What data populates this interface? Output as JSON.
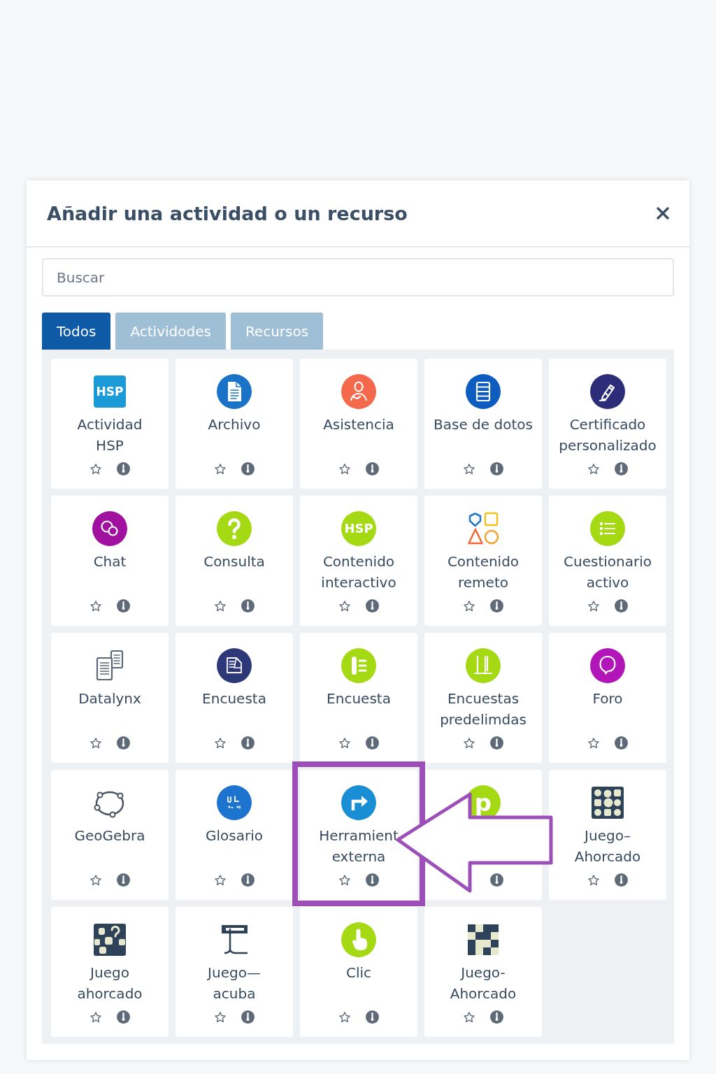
{
  "dialog": {
    "title": "Añadir una actividad o un recurso",
    "search": {
      "placeholder": "Buscar"
    },
    "tabs": [
      {
        "label": "Todos",
        "selected": true
      },
      {
        "label": "Actividodes",
        "selected": false
      },
      {
        "label": "Recursos",
        "selected": false
      }
    ],
    "items": [
      {
        "label": "Actividad\nHSP",
        "icon_text": "HSP",
        "starred": false,
        "highlighted": false
      },
      {
        "label": "Archivo",
        "starred": false,
        "highlighted": false
      },
      {
        "label": "Asistencia",
        "starred": false,
        "highlighted": false
      },
      {
        "label": "Base de dotos",
        "starred": false,
        "highlighted": false
      },
      {
        "label": "Certificado\npersonalizado",
        "starred": false,
        "highlighted": false
      },
      {
        "label": "Chat",
        "starred": false,
        "highlighted": false
      },
      {
        "label": "Consulta",
        "starred": false,
        "highlighted": false
      },
      {
        "label": "Contenido\ninteractivo",
        "icon_text": "HSP",
        "starred": false,
        "highlighted": false
      },
      {
        "label": "Contenido\nremeto",
        "starred": false,
        "highlighted": false
      },
      {
        "label": "Cuestionario\nactivo",
        "starred": false,
        "highlighted": false
      },
      {
        "label": "Datalynx",
        "starred": false,
        "highlighted": false
      },
      {
        "label": "Encuesta",
        "starred": false,
        "highlighted": false
      },
      {
        "label": "Encuesta",
        "starred": false,
        "highlighted": false
      },
      {
        "label": "Encuestas\npredelimdas",
        "starred": false,
        "highlighted": false
      },
      {
        "label": "Foro",
        "starred": false,
        "highlighted": false
      },
      {
        "label": "GeoGebra",
        "starred": false,
        "highlighted": false
      },
      {
        "label": "Glosario",
        "starred": false,
        "highlighted": false
      },
      {
        "label": "Herramient\nexterna",
        "starred": false,
        "highlighted": true
      },
      {
        "icon_text": "p",
        "highlighted": false
      },
      {
        "label": "Juego–\nAhorcado",
        "starred": false,
        "highlighted": false
      },
      {
        "label": "Juego\nahorcado",
        "starred": false,
        "highlighted": false
      },
      {
        "label": "Juego—\nacuba",
        "starred": false,
        "highlighted": false
      },
      {
        "label": "Clic",
        "starred": false,
        "highlighted": false
      },
      {
        "label": "Juego-\nAhorcado",
        "starred": false,
        "highlighted": false
      }
    ]
  }
}
